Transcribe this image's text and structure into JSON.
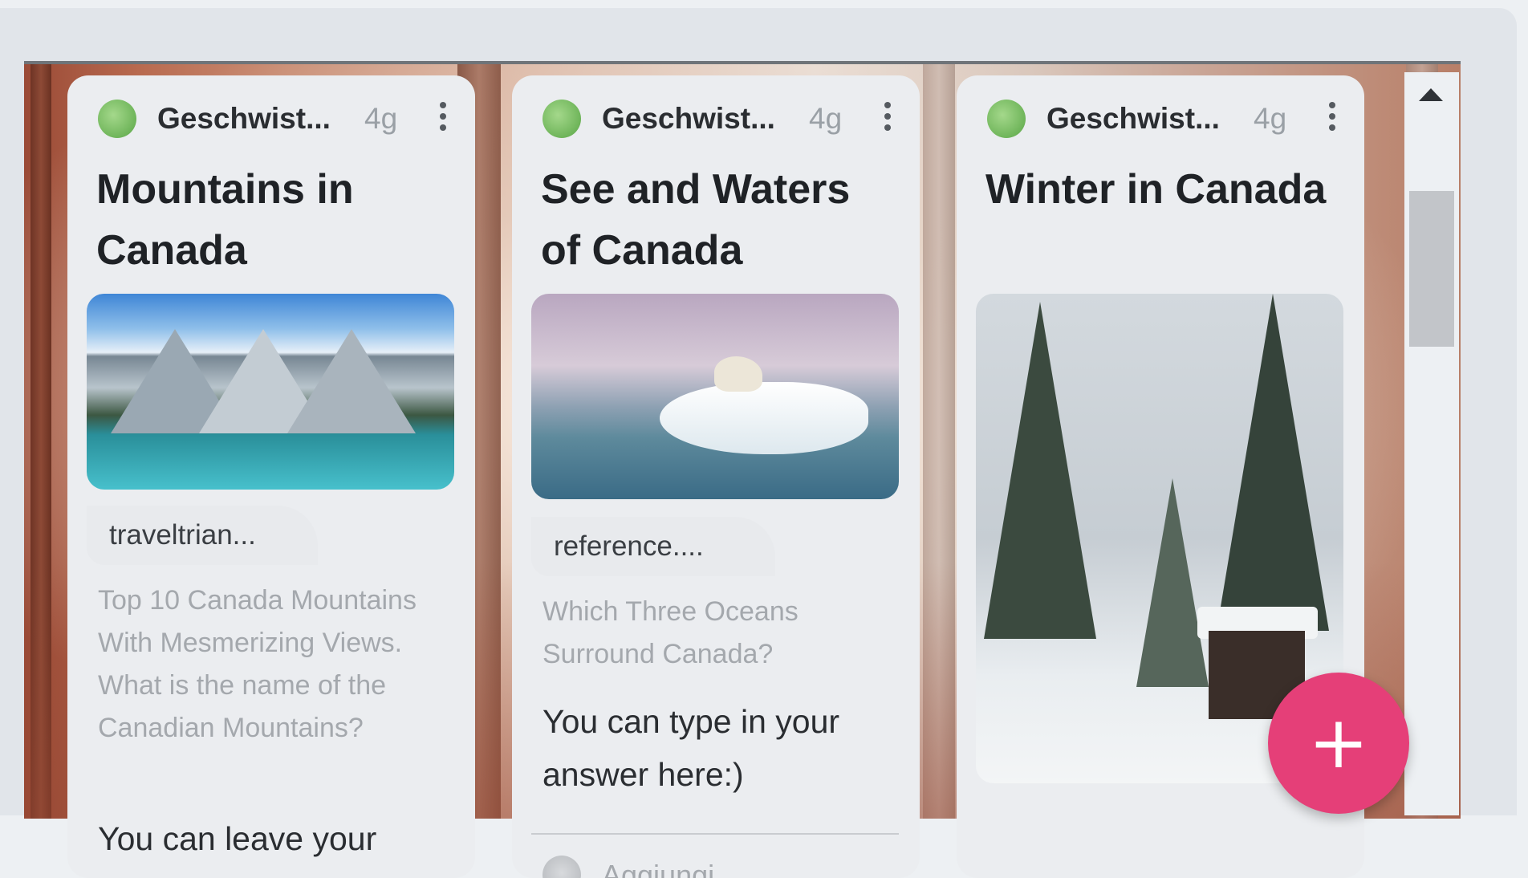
{
  "cards": [
    {
      "author": "Geschwist...",
      "time": "4g",
      "title": "Mountains in Canada",
      "source": "traveltrian...",
      "description": "Top 10 Canada Mountains With Mesmerizing Views. What is the name of the Canadian Mountains?",
      "answer": "You can leave your answer here:)"
    },
    {
      "author": "Geschwist...",
      "time": "4g",
      "title": "See and Waters of Canada",
      "source": "reference....",
      "description": "Which Three Oceans Surround Canada?",
      "answer": "You can type in your answer here:)",
      "comment_label": "Aggiungi"
    },
    {
      "author": "Geschwist...",
      "time": "4g",
      "title": "Winter in Canada"
    }
  ],
  "fab": {
    "label": "+",
    "accent": "#e53f78"
  },
  "icons": [
    "more-vert-icon",
    "scroll-up-arrow-icon",
    "plus-icon"
  ]
}
